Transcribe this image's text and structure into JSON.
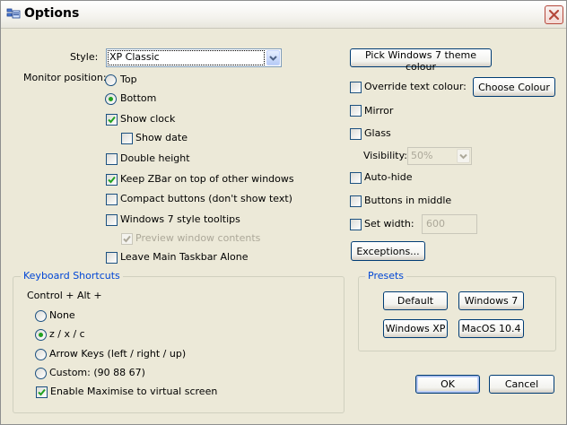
{
  "window": {
    "title": "Options",
    "title_icon": "options-window-icon",
    "close_icon": "close-icon"
  },
  "left": {
    "style_label": "Style:",
    "style_value": "XP Classic",
    "monitor_label": "Monitor position:",
    "monitor_options": {
      "top": "Top",
      "bottom": "Bottom",
      "selected": "Bottom"
    },
    "show_clock": {
      "label": "Show clock",
      "checked": true
    },
    "show_date": {
      "label": "Show date",
      "checked": false
    },
    "double_height": {
      "label": "Double height",
      "checked": false
    },
    "keep_on_top": {
      "label": "Keep ZBar on top of other windows",
      "checked": true
    },
    "compact_buttons": {
      "label": "Compact buttons (don't show text)",
      "checked": false
    },
    "win7_tooltips": {
      "label": "Windows 7 style tooltips",
      "checked": false
    },
    "preview_contents": {
      "label": "Preview window contents",
      "checked": true,
      "enabled": false
    },
    "leave_taskbar": {
      "label": "Leave Main Taskbar Alone",
      "checked": false
    }
  },
  "keyboard": {
    "group_title": "Keyboard Shortcuts",
    "modifier": "Control + Alt +",
    "options": {
      "none": "None",
      "zxc": "z / x / c",
      "arrows": "Arrow Keys (left / right / up)",
      "custom": "Custom: (90 88 67)"
    },
    "selected": "z / x / c",
    "enable_maximise": {
      "label": "Enable Maximise to virtual screen",
      "checked": true
    }
  },
  "right": {
    "pick_theme_button": "Pick Windows 7 theme colour",
    "override_text": {
      "label": "Override text colour:",
      "checked": false
    },
    "choose_colour_button": "Choose Colour",
    "mirror": {
      "label": "Mirror",
      "checked": false
    },
    "glass": {
      "label": "Glass",
      "checked": false
    },
    "visibility_label": "Visibility:",
    "visibility_value": "50%",
    "auto_hide": {
      "label": "Auto-hide",
      "checked": false
    },
    "buttons_middle": {
      "label": "Buttons in middle",
      "checked": false
    },
    "set_width": {
      "label": "Set width:",
      "checked": false
    },
    "width_value": "600",
    "exceptions_button": "Exceptions..."
  },
  "presets": {
    "group_title": "Presets",
    "default": "Default",
    "windows7": "Windows 7",
    "windowsxp": "Windows XP",
    "macos": "MacOS 10.4"
  },
  "footer": {
    "ok": "OK",
    "cancel": "Cancel"
  },
  "colors": {
    "titlebar": "#f4f3ee",
    "dialog_bg": "#ece9d8",
    "group_title": "#0046d5",
    "button_border": "#003c74",
    "check_green": "#21a121",
    "close_red": "#b5483b"
  }
}
